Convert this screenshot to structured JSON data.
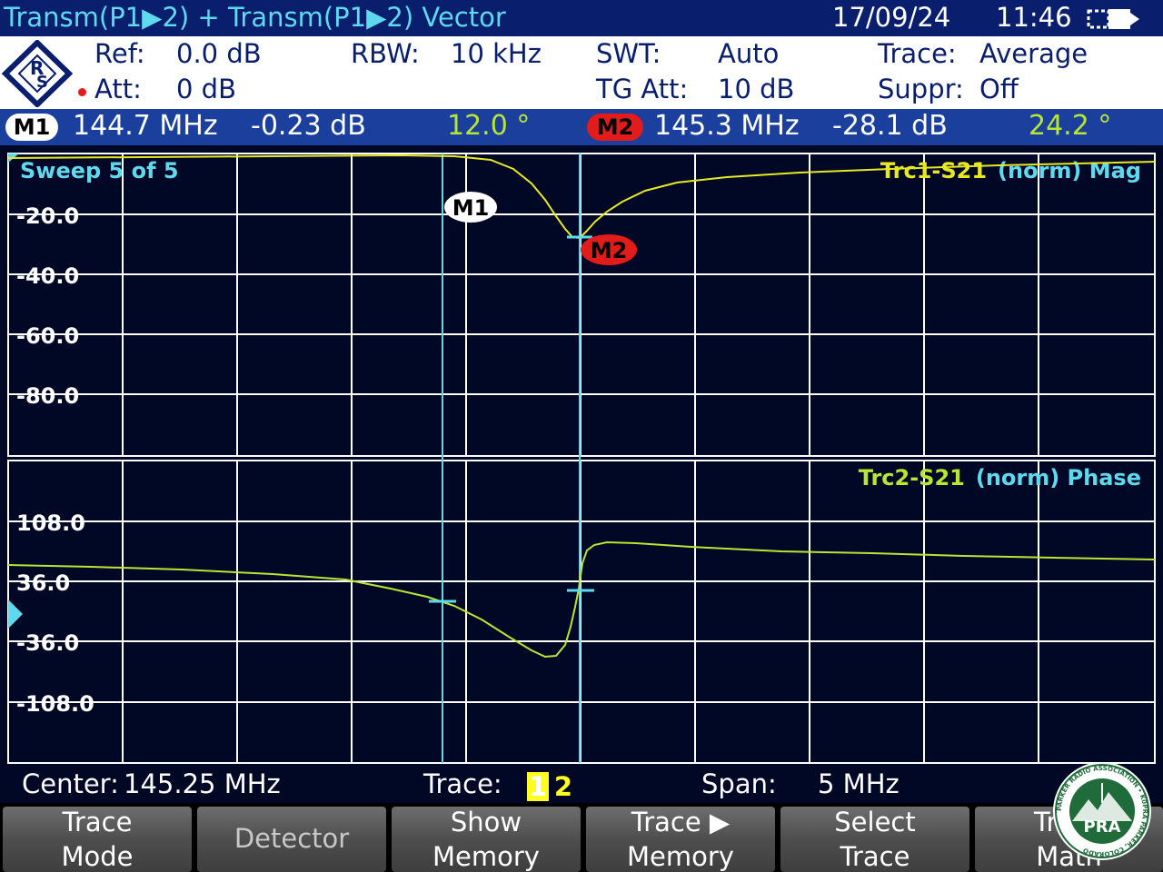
{
  "title_bar": {
    "title": "Transm(P1▶2) + Transm(P1▶2) Vector",
    "date": "17/09/24",
    "time": "11:46"
  },
  "settings": {
    "ref_label": "Ref:",
    "ref_value": "0.0 dB",
    "att_label": "Att:",
    "att_value": "0 dB",
    "rbw_label": "RBW:",
    "rbw_value": "10 kHz",
    "swt_label": "SWT:",
    "swt_value": "Auto",
    "tg_att_label": "TG Att:",
    "tg_att_value": "10 dB",
    "trace_label": "Trace:",
    "trace_value": "Average",
    "suppr_label": "Suppr:",
    "suppr_value": "Off"
  },
  "markers": {
    "m1": {
      "label": "M1",
      "freq": "144.7 MHz",
      "mag": "-0.23 dB",
      "phase": "12.0 °"
    },
    "m2": {
      "label": "M2",
      "freq": "145.3 MHz",
      "mag": "-28.1 dB",
      "phase": "24.2 °"
    }
  },
  "upper_plot": {
    "sweep": "Sweep 5 of 5",
    "trace_title_a": "Trc1-S21",
    "trace_title_b": "(norm) Mag",
    "y_labels": [
      "-20.0",
      "-40.0",
      "-60.0",
      "-80.0"
    ],
    "marker_labels": [
      "M1",
      "M2"
    ]
  },
  "lower_plot": {
    "trace_title_a": "Trc2-S21",
    "trace_title_b": "(norm) Phase",
    "y_labels": [
      "108.0",
      "36.0",
      "-36.0",
      "-108.0"
    ]
  },
  "status": {
    "center_label": "Center:",
    "center_value": "145.25 MHz",
    "trace_label": "Trace:",
    "trace_1": "1",
    "trace_2": "2",
    "span_label": "Span:",
    "span_value": "5 MHz"
  },
  "softkeys": {
    "trace_mode_1": "Trace",
    "trace_mode_2": "Mode",
    "detector": "Detector",
    "show_memory_1": "Show",
    "show_memory_2": "Memory",
    "trace_to_memory_1": "Trace ▶",
    "trace_to_memory_2": "Memory",
    "select_trace_1": "Select",
    "select_trace_2": "Trace",
    "trace_math_1": "Trace",
    "trace_math_2": "Math"
  },
  "watermark": {
    "text": "PRA",
    "ring_text": "PARKER RADIO ASSOCIATION • K0PRA PARKER, COLORADO"
  },
  "colors": {
    "title_bg": "#0a1e6e",
    "cyan": "#5fd9ee",
    "mag_trace": "#e8e822",
    "phase_trace": "#b8e634",
    "marker_m2": "#e21b1b",
    "plot_bg": "#000825"
  },
  "icons": {
    "battery": "battery-icon",
    "logo": "rohde-schwarz-logo",
    "ref_marker": "triangle-right-icon"
  }
}
